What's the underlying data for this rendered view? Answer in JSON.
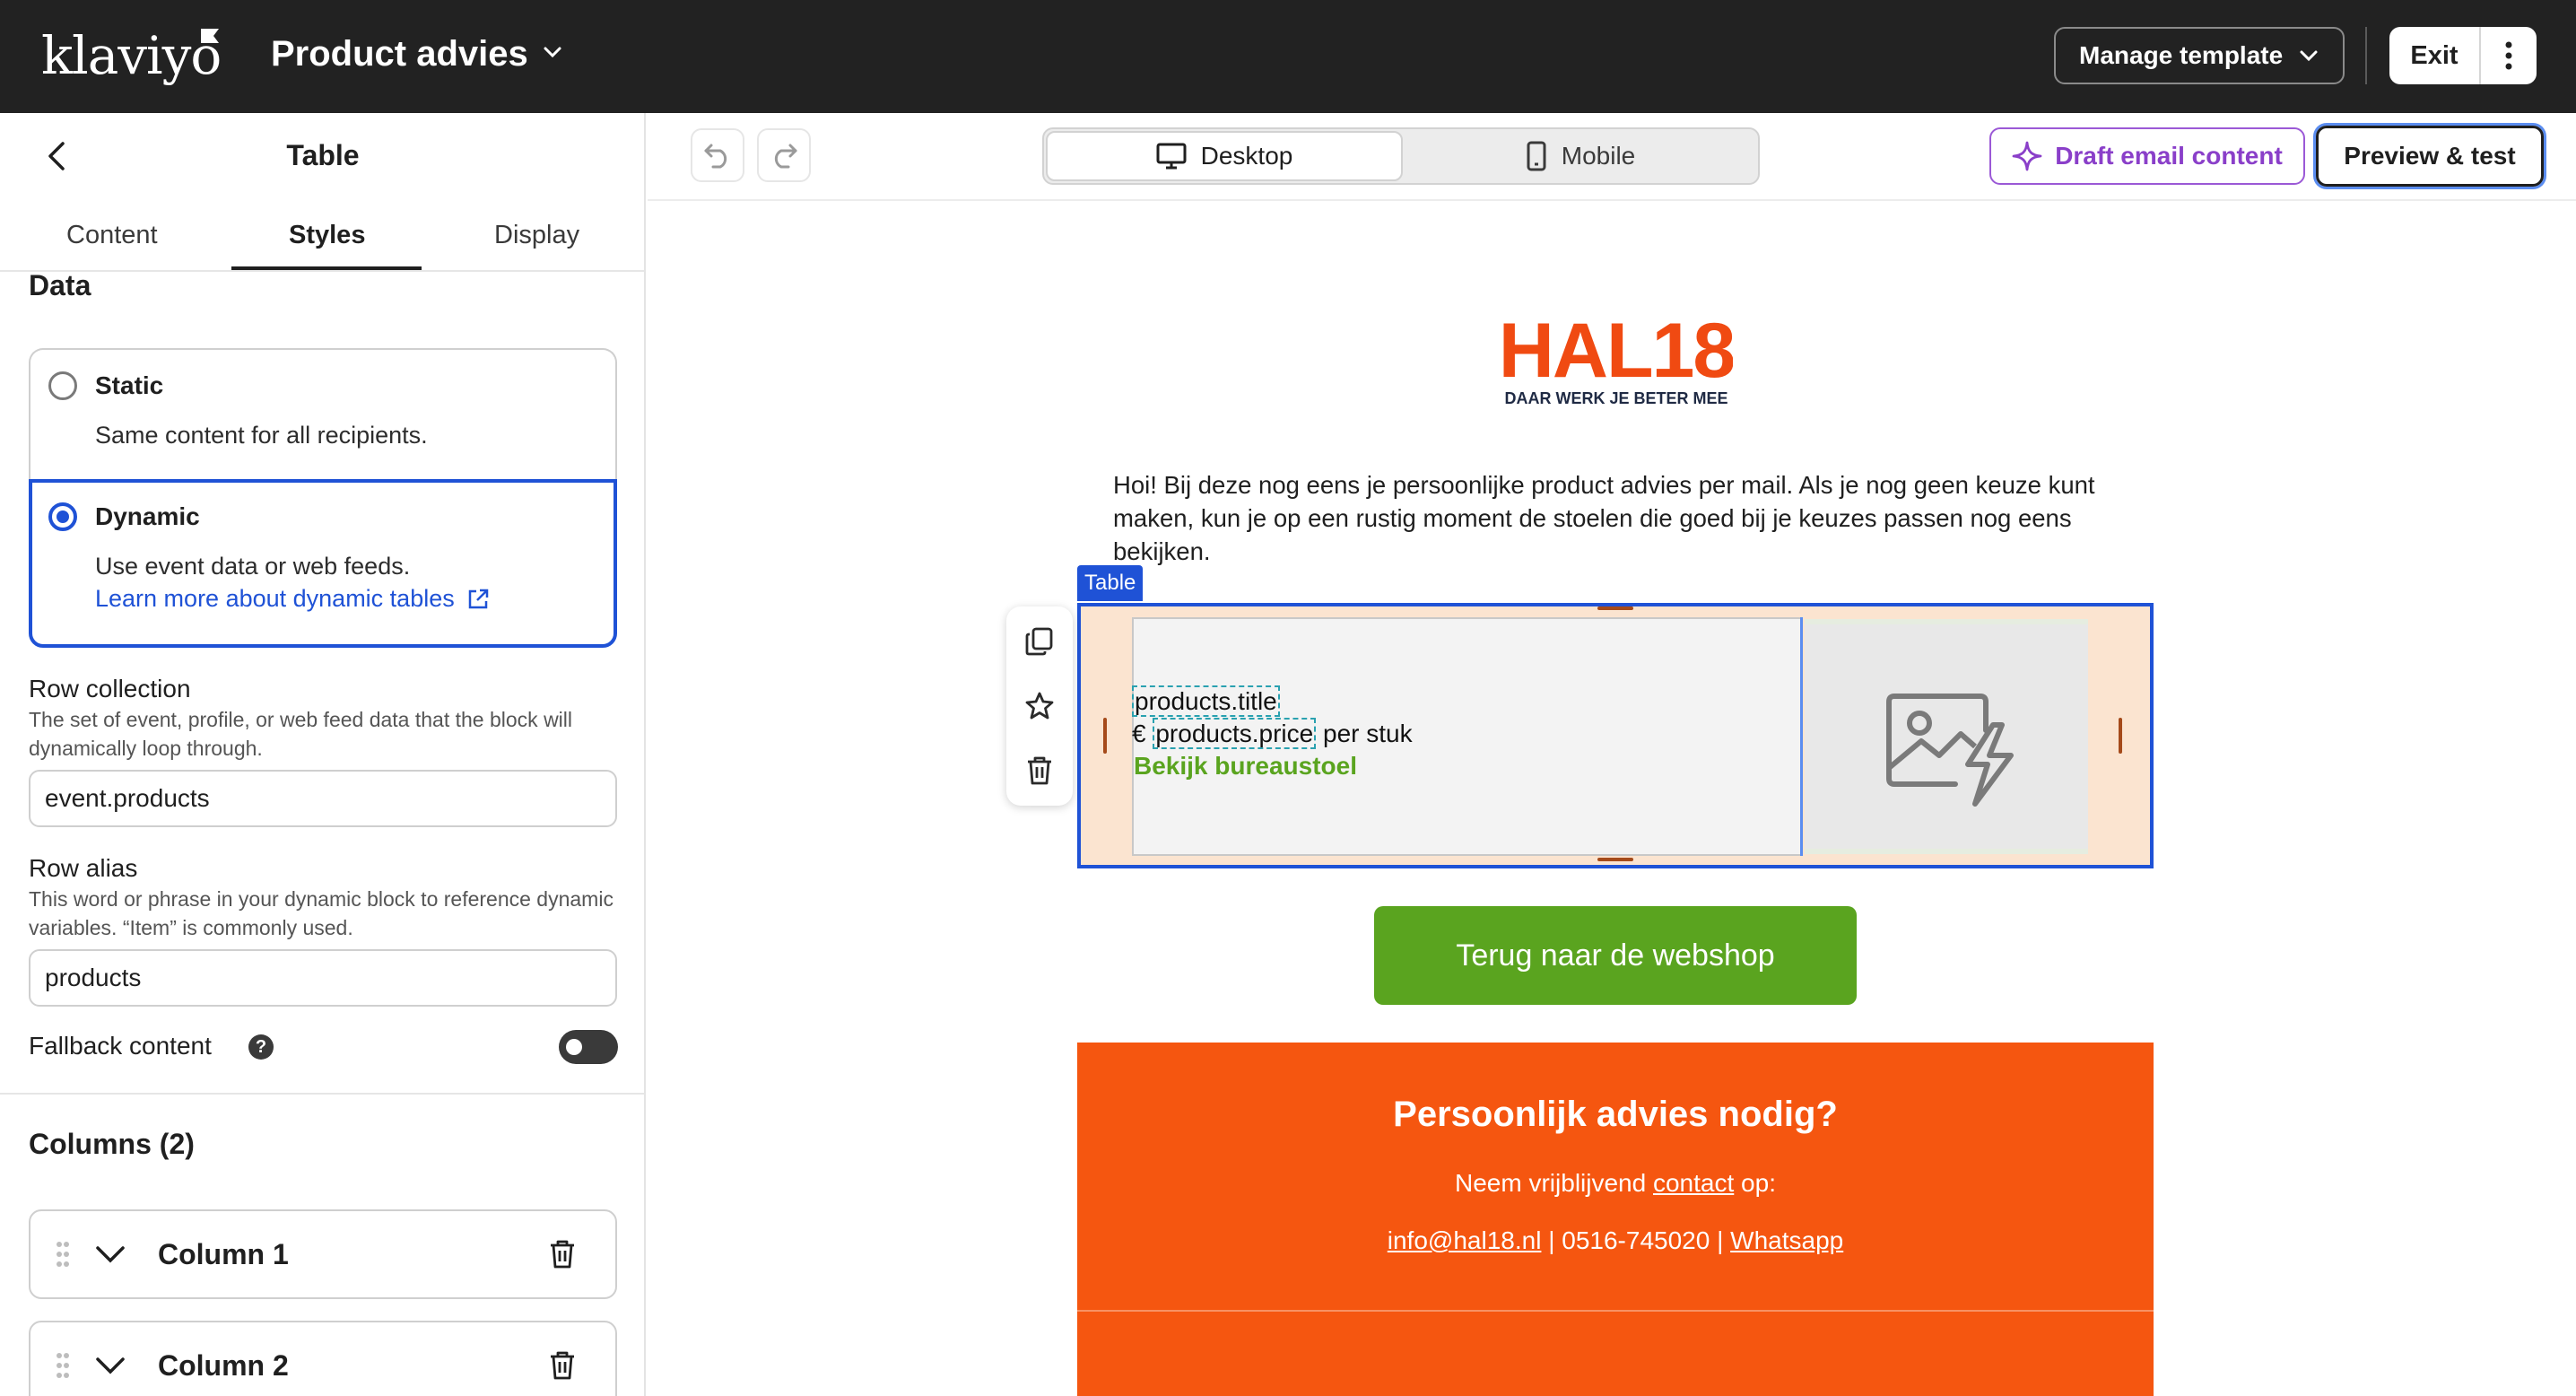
{
  "app": {
    "brand": "klaviyo",
    "template_name": "Product advies",
    "manage_template_label": "Manage template",
    "exit_label": "Exit"
  },
  "panel": {
    "title": "Table",
    "tabs": [
      {
        "label": "Content"
      },
      {
        "label": "Styles",
        "active": true
      },
      {
        "label": "Display"
      }
    ],
    "data_section": "Data",
    "static_option": {
      "label": "Static",
      "description": "Same content for all recipients."
    },
    "dynamic_option": {
      "label": "Dynamic",
      "description": "Use event data or web feeds.",
      "link": "Learn more about dynamic tables",
      "selected": true
    },
    "row_collection": {
      "label": "Row collection",
      "help": "The set of event, profile, or web feed data that the block will dynamically loop through.",
      "value": "event.products"
    },
    "row_alias": {
      "label": "Row alias",
      "help": "This word or phrase in your dynamic block to reference dynamic variables. “Item” is commonly used.",
      "value": "products"
    },
    "fallback": {
      "label": "Fallback content",
      "help_glyph": "?",
      "enabled": false
    },
    "columns_heading": "Columns (2)",
    "columns": [
      {
        "label": "Column 1"
      },
      {
        "label": "Column 2"
      }
    ]
  },
  "toolbar": {
    "desktop_label": "Desktop",
    "mobile_label": "Mobile",
    "draft_label": "Draft email content",
    "preview_label": "Preview & test"
  },
  "email": {
    "logo_text": "HAL18",
    "logo_tagline": "DAAR WERK JE BETER MEE",
    "intro": "Hoi! Bij deze nog eens je persoonlijke product advies per mail. Als je nog geen keuze kunt maken, kun je op een rustig moment de stoelen die goed bij je keuzes passen nog eens bekijken.",
    "table_tag": "Table",
    "row": {
      "title_var": "products.title",
      "price_prefix": "€ ",
      "price_var": "products.price",
      "price_suffix": " per stuk",
      "link": "Bekijk bureaustoel"
    },
    "cta": "Terug naar de webshop",
    "footer": {
      "heading": "Persoonlijk advies nodig?",
      "line1_prefix": "Neem vrijblijvend ",
      "line1_link": "contact",
      "line1_suffix": " op:",
      "email": "info@hal18.nl",
      "sep1": " | 0516-745020 | ",
      "whatsapp": "Whatsapp"
    }
  },
  "colors": {
    "topbar": "#222222",
    "accent_blue": "#1f52d6",
    "draft_purple": "#8a3fc9",
    "brand_orange": "#f55610",
    "cta_green": "#5aa41f",
    "table_bg": "#fbe4d0"
  },
  "icons": [
    "chevron-down-icon",
    "more-vertical-icon",
    "back-arrow-icon",
    "external-link-icon",
    "help-icon",
    "drag-handle-icon",
    "trash-icon",
    "undo-icon",
    "redo-icon",
    "monitor-icon",
    "phone-icon",
    "sparkle-icon",
    "copy-icon",
    "star-icon",
    "image-placeholder-icon"
  ]
}
